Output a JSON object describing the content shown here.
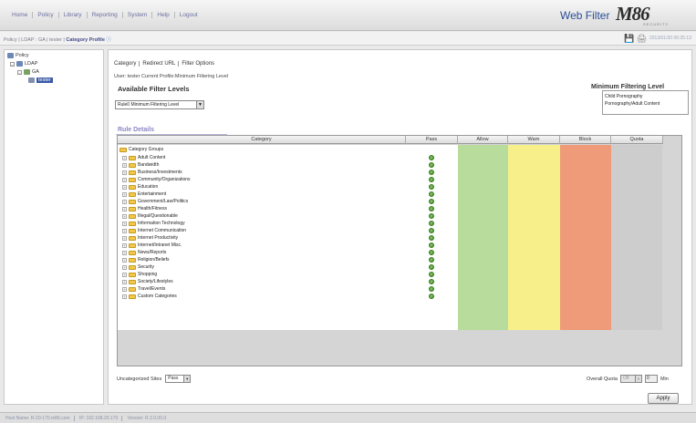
{
  "nav": [
    "Home",
    "Policy",
    "Library",
    "Reporting",
    "System",
    "Help",
    "Logout"
  ],
  "product": "Web Filter",
  "logo": {
    "mark": "M86",
    "sub": "SECURITY"
  },
  "breadcrumb": {
    "path": "Policy | LDAP : GA | tester | ",
    "current": "Category Profile"
  },
  "timestamp": "2013/01/20 06:25:13",
  "tree": {
    "root": "Policy",
    "ldap": "LDAP",
    "ga": "GA",
    "user": "tester"
  },
  "tabs": [
    "Category",
    "Redirect URL",
    "Filter Options"
  ],
  "user_line": "User: tester   Current Profile:Minimum Filtering Level",
  "available_title": "Available Filter Levels",
  "filter_level_selected": "Rule0 Minimum Filtering Level",
  "min_title": "Minimum Filtering Level",
  "min_items": [
    "Child Pornography",
    "Pornography/Adult Content"
  ],
  "rule_title": "Rule Details",
  "columns": [
    "Category",
    "Pass",
    "Allow",
    "Warn",
    "Block",
    "Quota"
  ],
  "column_colors": {
    "allow": "#b8dc9c",
    "warn": "#f7f08a",
    "block": "#ef9a78",
    "quota": "#cdcdcd"
  },
  "group_label": "Category Groups",
  "categories": [
    "Adult Content",
    "Bandwidth",
    "Business/Investments",
    "Community/Organizations",
    "Education",
    "Entertainment",
    "Government/Law/Politics",
    "Health/Fitness",
    "Illegal/Questionable",
    "Information Technology",
    "Internet Communication",
    "Internet Productivity",
    "Internet/Intranet Misc.",
    "News/Reports",
    "Religion/Beliefs",
    "Security",
    "Shopping",
    "Society/Lifestyles",
    "Travel/Events",
    "Custom Categories"
  ],
  "uncategorized_label": "Uncategorized Sites",
  "uncategorized_value": "Pass",
  "overall_quota_label": "Overall Quota",
  "overall_quota_value": "Off",
  "quota_minutes": "0",
  "quota_unit": "Min",
  "apply_label": "Apply",
  "status": [
    "Host Name: R-20-170.m86.com",
    "IP: 192.168.20.170",
    "Version: R 2.0.00.0"
  ]
}
